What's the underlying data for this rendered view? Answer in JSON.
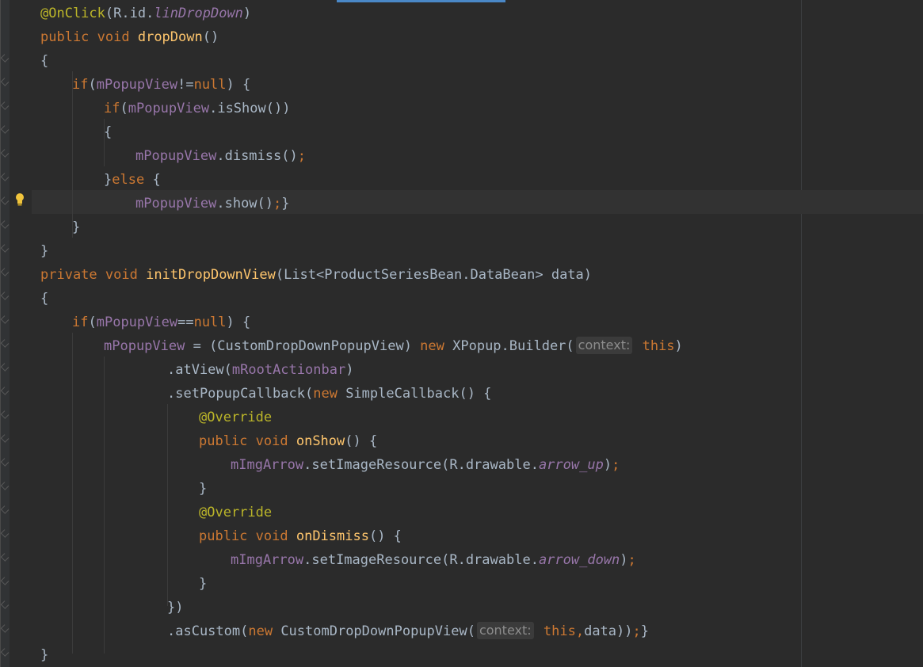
{
  "editor": {
    "lines": [
      [
        [
          "ann",
          "@OnClick"
        ],
        [
          "p",
          "("
        ],
        [
          "p",
          "R.id."
        ],
        [
          "fld it",
          "linDropDown"
        ],
        [
          "p",
          ")"
        ]
      ],
      [
        [
          "kw",
          "public "
        ],
        [
          "kw",
          "void "
        ],
        [
          "fn",
          "dropDown"
        ],
        [
          "p",
          "()"
        ]
      ],
      [
        [
          "p",
          "{"
        ]
      ],
      [
        [
          "kw",
          "if"
        ],
        [
          "p",
          "("
        ],
        [
          "fld",
          "mPopupView"
        ],
        [
          "p",
          "!="
        ],
        [
          "kw",
          "null"
        ],
        [
          "p",
          ") {"
        ]
      ],
      [
        [
          "kw",
          "if"
        ],
        [
          "p",
          "("
        ],
        [
          "fld",
          "mPopupView"
        ],
        [
          "p",
          ".isShow())"
        ]
      ],
      [
        [
          "p",
          "{"
        ]
      ],
      [
        [
          "fld",
          "mPopupView"
        ],
        [
          "p",
          ".dismiss()"
        ],
        [
          "kw",
          ";"
        ]
      ],
      [
        [
          "p",
          "}"
        ],
        [
          "kw",
          "else "
        ],
        [
          "p",
          "{"
        ]
      ],
      [
        [
          "fld",
          "mPopupView"
        ],
        [
          "p",
          ".show()"
        ],
        [
          "kw",
          ";"
        ],
        [
          "p",
          "}"
        ]
      ],
      [
        [
          "p",
          "}"
        ]
      ],
      [
        [
          "p",
          "}"
        ]
      ],
      [
        [
          "kw",
          "private "
        ],
        [
          "kw",
          "void "
        ],
        [
          "fn",
          "initDropDownView"
        ],
        [
          "p",
          "(List<ProductSeriesBean.DataBean> data)"
        ]
      ],
      [
        [
          "p",
          "{"
        ]
      ],
      [
        [
          "kw",
          "if"
        ],
        [
          "p",
          "("
        ],
        [
          "fld",
          "mPopupView"
        ],
        [
          "p",
          "=="
        ],
        [
          "kw",
          "null"
        ],
        [
          "p",
          ") {"
        ]
      ],
      [
        [
          "fld",
          "mPopupView"
        ],
        [
          "p",
          " = (CustomDropDownPopupView) "
        ],
        [
          "kw",
          "new "
        ],
        [
          "p",
          "XPopup.Builder("
        ],
        [
          "hint",
          "context:"
        ],
        [
          "kw",
          " this"
        ],
        [
          "p",
          ")"
        ]
      ],
      [
        [
          "p",
          ".atView("
        ],
        [
          "fld",
          "mRootActionbar"
        ],
        [
          "p",
          ")"
        ]
      ],
      [
        [
          "p",
          ".setPopupCallback("
        ],
        [
          "kw",
          "new "
        ],
        [
          "p",
          "SimpleCallback() {"
        ]
      ],
      [
        [
          "ann",
          "@Override"
        ]
      ],
      [
        [
          "kw",
          "public "
        ],
        [
          "kw",
          "void "
        ],
        [
          "fn",
          "onShow"
        ],
        [
          "p",
          "() {"
        ]
      ],
      [
        [
          "fld",
          "mImgArrow"
        ],
        [
          "p",
          ".setImageResource(R.drawable."
        ],
        [
          "fld it",
          "arrow_up"
        ],
        [
          "p",
          ")"
        ],
        [
          "kw",
          ";"
        ]
      ],
      [
        [
          "p",
          "}"
        ]
      ],
      [
        [
          "ann",
          "@Override"
        ]
      ],
      [
        [
          "kw",
          "public "
        ],
        [
          "kw",
          "void "
        ],
        [
          "fn",
          "onDismiss"
        ],
        [
          "p",
          "() {"
        ]
      ],
      [
        [
          "fld",
          "mImgArrow"
        ],
        [
          "p",
          ".setImageResource(R.drawable."
        ],
        [
          "fld it",
          "arrow_down"
        ],
        [
          "p",
          ")"
        ],
        [
          "kw",
          ";"
        ]
      ],
      [
        [
          "p",
          "}"
        ]
      ],
      [
        [
          "p",
          "})"
        ]
      ],
      [
        [
          "p",
          ".asCustom("
        ],
        [
          "kw",
          "new "
        ],
        [
          "p",
          "CustomDropDownPopupView("
        ],
        [
          "hint",
          "context:"
        ],
        [
          "kw",
          " this,"
        ],
        [
          "p",
          "data))"
        ],
        [
          "kw",
          ";"
        ],
        [
          "p",
          "}"
        ]
      ],
      [
        [
          "p",
          "}"
        ]
      ]
    ]
  }
}
